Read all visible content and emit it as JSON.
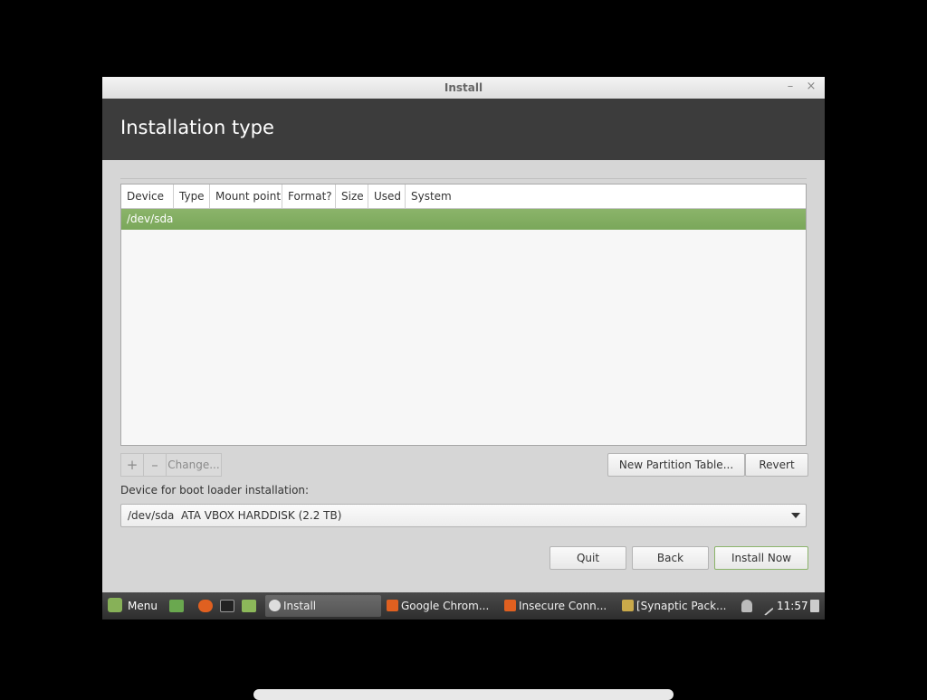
{
  "window": {
    "title": "Install",
    "minimize_glyph": "–",
    "close_glyph": "×"
  },
  "header": {
    "title": "Installation type"
  },
  "table": {
    "columns": [
      "Device",
      "Type",
      "Mount point",
      "Format?",
      "Size",
      "Used",
      "System"
    ],
    "rows": [
      {
        "device": "/dev/sda",
        "selected": true
      }
    ]
  },
  "toolbar": {
    "add_label": "+",
    "remove_label": "–",
    "change_label": "Change..."
  },
  "actions": {
    "new_partition_table_label": "New Partition Table...",
    "revert_label": "Revert"
  },
  "bootloader": {
    "label": "Device for boot loader installation:",
    "selected": "/dev/sda  ATA VBOX HARDDISK (2.2 TB)"
  },
  "footer": {
    "quit_label": "Quit",
    "back_label": "Back",
    "install_label": "Install Now"
  },
  "taskbar": {
    "menu_label": "Menu",
    "windows": [
      {
        "label": "Install",
        "icon": "install-disc-icon",
        "active": true
      },
      {
        "label": "Google Chrom...",
        "icon": "browser-icon",
        "active": false
      },
      {
        "label": "Insecure Conn...",
        "icon": "firefox-icon",
        "active": false
      },
      {
        "label": "[Synaptic Pack...",
        "icon": "package-icon",
        "active": false
      }
    ],
    "clock": "11:57"
  },
  "colors": {
    "accent": "#87b158",
    "header_bg": "#3c3c3c"
  }
}
